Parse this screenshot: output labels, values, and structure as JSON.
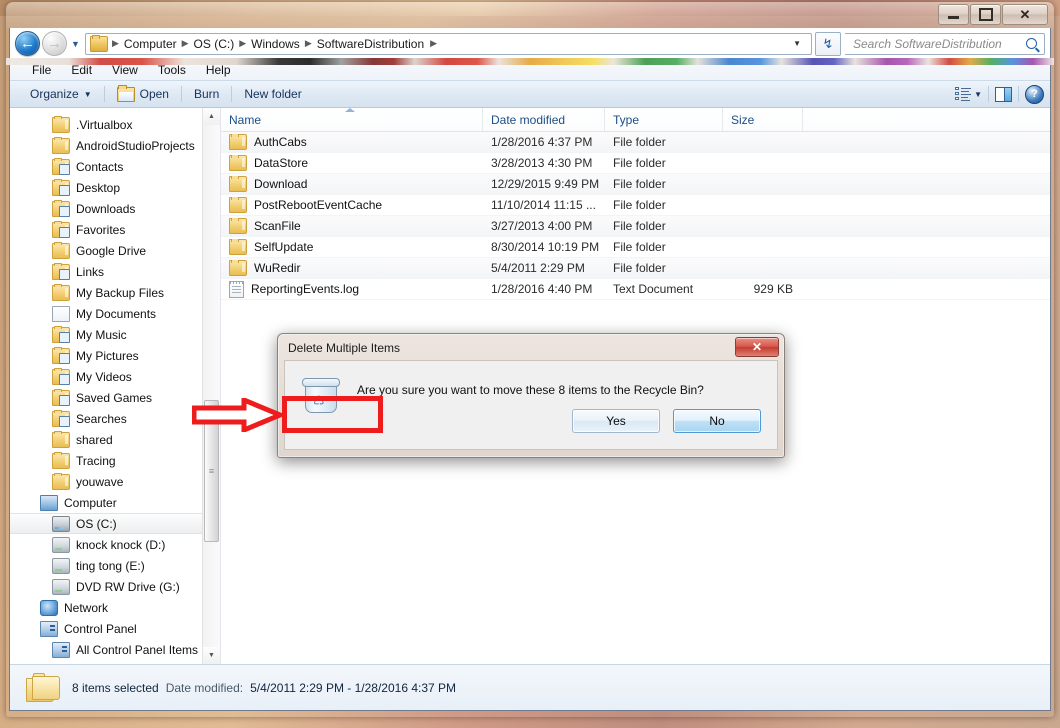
{
  "window": {
    "controls": {
      "minimize": "–",
      "maximize": "❐",
      "close": "✕"
    }
  },
  "address": {
    "back_label": "◀",
    "forward_label": "▶",
    "history_caret": "▼",
    "crumbs": [
      "Computer",
      "OS (C:)",
      "Windows",
      "SoftwareDistribution"
    ],
    "separator": "▶",
    "trailing_arrow": "▶",
    "dropdown_caret": "▼",
    "refresh_label": "↯"
  },
  "search": {
    "placeholder": "Search SoftwareDistribution",
    "icon": "search-icon"
  },
  "menubar": {
    "items": [
      "File",
      "Edit",
      "View",
      "Tools",
      "Help"
    ]
  },
  "toolbar": {
    "organize_label": "Organize",
    "organize_caret": "▼",
    "open_label": "Open",
    "burn_label": "Burn",
    "new_folder_label": "New folder",
    "view_caret": "▼",
    "help_label": "?"
  },
  "navigation": {
    "items": [
      {
        "label": ".Virtualbox",
        "icon": "folder-icon",
        "level": 2,
        "selected": false
      },
      {
        "label": "AndroidStudioProjects",
        "icon": "folder-icon",
        "level": 2,
        "selected": false
      },
      {
        "label": "Contacts",
        "icon": "contacts-folder-icon",
        "level": 2,
        "selected": false
      },
      {
        "label": "Desktop",
        "icon": "desktop-folder-icon",
        "level": 2,
        "selected": false
      },
      {
        "label": "Downloads",
        "icon": "downloads-folder-icon",
        "level": 2,
        "selected": false
      },
      {
        "label": "Favorites",
        "icon": "favorites-folder-icon",
        "level": 2,
        "selected": false
      },
      {
        "label": "Google Drive",
        "icon": "folder-icon",
        "level": 2,
        "selected": false
      },
      {
        "label": "Links",
        "icon": "links-folder-icon",
        "level": 2,
        "selected": false
      },
      {
        "label": "My Backup Files",
        "icon": "folder-icon",
        "level": 2,
        "selected": false
      },
      {
        "label": "My Documents",
        "icon": "documents-folder-icon",
        "level": 2,
        "selected": false
      },
      {
        "label": "My Music",
        "icon": "music-folder-icon",
        "level": 2,
        "selected": false
      },
      {
        "label": "My Pictures",
        "icon": "pictures-folder-icon",
        "level": 2,
        "selected": false
      },
      {
        "label": "My Videos",
        "icon": "videos-folder-icon",
        "level": 2,
        "selected": false
      },
      {
        "label": "Saved Games",
        "icon": "saved-games-folder-icon",
        "level": 2,
        "selected": false
      },
      {
        "label": "Searches",
        "icon": "searches-folder-icon",
        "level": 2,
        "selected": false
      },
      {
        "label": "shared",
        "icon": "folder-icon",
        "level": 2,
        "selected": false
      },
      {
        "label": "Tracing",
        "icon": "folder-icon",
        "level": 2,
        "selected": false
      },
      {
        "label": "youwave",
        "icon": "folder-icon",
        "level": 2,
        "selected": false
      },
      {
        "label": "Computer",
        "icon": "computer-icon",
        "level": 1,
        "selected": false
      },
      {
        "label": "OS (C:)",
        "icon": "hard-disk-icon",
        "level": 2,
        "selected": true
      },
      {
        "label": "knock knock (D:)",
        "icon": "removable-disk-icon",
        "level": 2,
        "selected": false
      },
      {
        "label": "ting tong (E:)",
        "icon": "removable-disk-icon",
        "level": 2,
        "selected": false
      },
      {
        "label": "DVD RW Drive (G:)",
        "icon": "dvd-drive-icon",
        "level": 2,
        "selected": false
      },
      {
        "label": "Network",
        "icon": "network-icon",
        "level": 1,
        "selected": false
      },
      {
        "label": "Control Panel",
        "icon": "control-panel-icon",
        "level": 1,
        "selected": false
      },
      {
        "label": "All Control Panel Items",
        "icon": "control-panel-icon",
        "level": 2,
        "selected": false
      }
    ],
    "scroll_up": "▲",
    "scroll_down": "▼"
  },
  "filelist": {
    "columns": [
      "Name",
      "Date modified",
      "Type",
      "Size"
    ],
    "sort_column": "Name",
    "sort_direction": "ascending",
    "rows": [
      {
        "name": "AuthCabs",
        "date": "1/28/2016 4:37 PM",
        "type": "File folder",
        "size": "",
        "icon": "folder-icon"
      },
      {
        "name": "DataStore",
        "date": "3/28/2013 4:30 PM",
        "type": "File folder",
        "size": "",
        "icon": "folder-icon"
      },
      {
        "name": "Download",
        "date": "12/29/2015 9:49 PM",
        "type": "File folder",
        "size": "",
        "icon": "folder-icon"
      },
      {
        "name": "PostRebootEventCache",
        "date": "11/10/2014 11:15 ...",
        "type": "File folder",
        "size": "",
        "icon": "folder-icon"
      },
      {
        "name": "ScanFile",
        "date": "3/27/2013 4:00 PM",
        "type": "File folder",
        "size": "",
        "icon": "folder-icon"
      },
      {
        "name": "SelfUpdate",
        "date": "8/30/2014 10:19 PM",
        "type": "File folder",
        "size": "",
        "icon": "folder-icon"
      },
      {
        "name": "WuRedir",
        "date": "5/4/2011 2:29 PM",
        "type": "File folder",
        "size": "",
        "icon": "folder-icon"
      },
      {
        "name": "ReportingEvents.log",
        "date": "1/28/2016 4:40 PM",
        "type": "Text Document",
        "size": "929 KB",
        "icon": "text-document-icon"
      }
    ]
  },
  "statusbar": {
    "selection": "8 items selected",
    "date_label": "Date modified:",
    "date_value": "5/4/2011 2:29 PM - 1/28/2016 4:37 PM"
  },
  "dialog": {
    "title": "Delete Multiple Items",
    "close_label": "✕",
    "icon": "recycle-bin-icon",
    "message": "Are you sure you want to move these 8 items to the Recycle Bin?",
    "yes_label": "Yes",
    "no_label": "No",
    "annotation": {
      "highlight_color": "#ee1c1c",
      "arrow_color": "#ee1c1c",
      "target": "Yes"
    }
  }
}
